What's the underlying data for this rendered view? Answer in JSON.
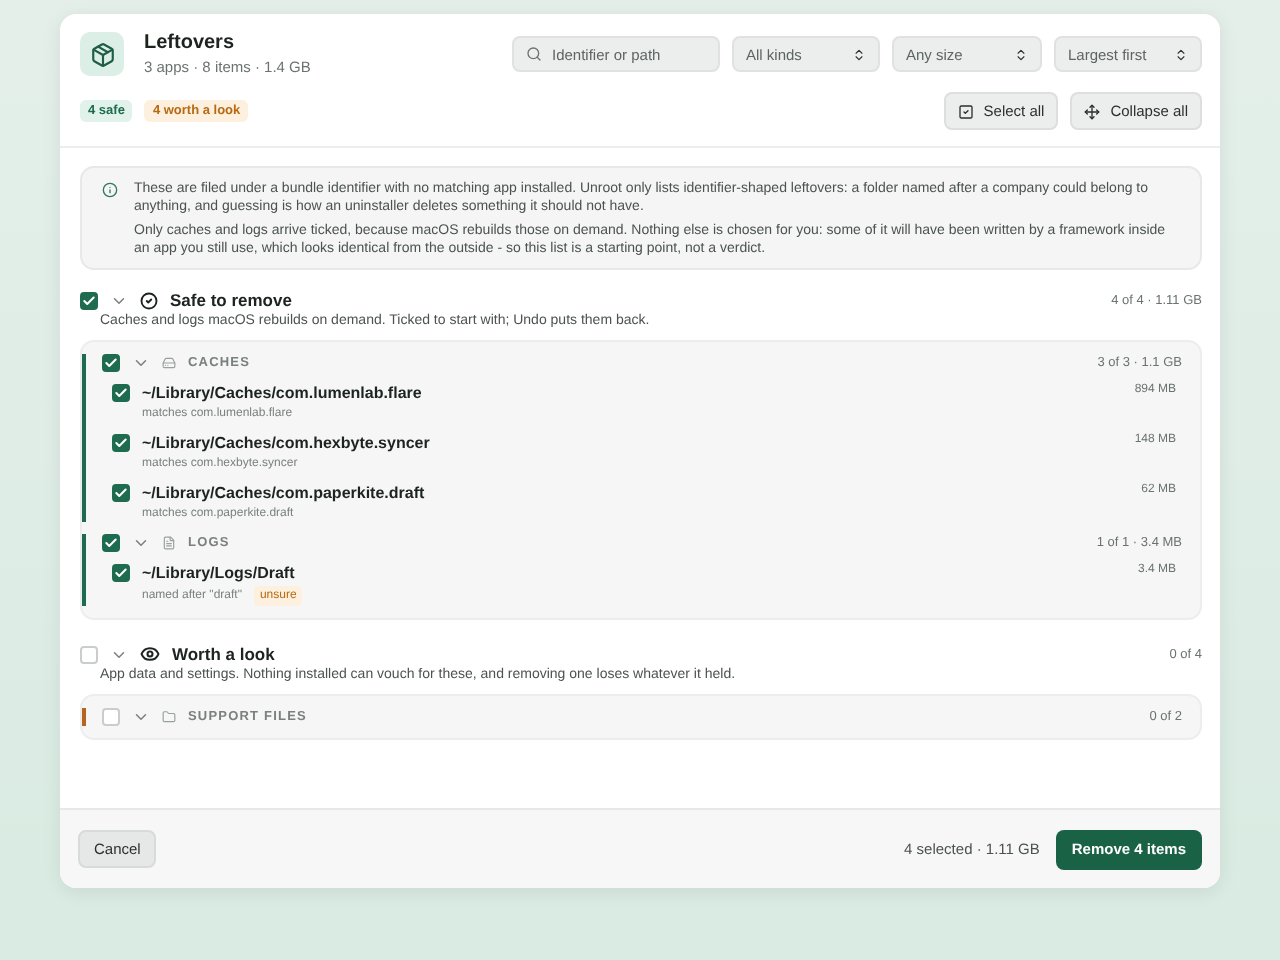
{
  "header": {
    "title": "Leftovers",
    "subtitle": "3 apps · 8 items · 1.4 GB",
    "search": {
      "placeholder": "Identifier or path"
    },
    "filters": [
      {
        "value": "All kinds"
      },
      {
        "value": "Any size"
      },
      {
        "value": "Largest first"
      }
    ],
    "badges": [
      {
        "label": "4 safe",
        "kind": "safe"
      },
      {
        "label": "4 worth a look",
        "kind": "review"
      }
    ],
    "actions": [
      {
        "label": "Select all",
        "kind": "select"
      },
      {
        "label": "Collapse all",
        "kind": "collapse"
      }
    ]
  },
  "notice": {
    "paragraphs": [
      "These are filed under a bundle identifier with no matching app installed. Unroot only lists identifier-shaped leftovers: a folder named after a company could belong to anything, and guessing is how an uninstaller deletes something it should not have.",
      "Only caches and logs arrive ticked, because macOS rebuilds those on demand. Nothing else is chosen for you: some of it will have been written by a framework inside an app you still use, which looks identical from the outside - so this list is a starting point, not a verdict."
    ]
  },
  "sections": [
    {
      "title": "Safe to remove",
      "kind": "safe",
      "checked": true,
      "expanded": true,
      "count": "4 of 4 · 1.11 GB",
      "description": "Caches and logs macOS rebuilds on demand. Ticked to start with; Undo puts them back.",
      "groups": [
        {
          "label": "CACHES",
          "kind": "caches",
          "color": "#1f6b4f",
          "checked": true,
          "expanded": true,
          "count": "3 of 3 · 1.1 GB",
          "items": [
            {
              "path": "~/Library/Caches/com.lumenlab.flare",
              "note": "matches com.lumenlab.flare",
              "size": "894 MB",
              "checked": true
            },
            {
              "path": "~/Library/Caches/com.hexbyte.syncer",
              "note": "matches com.hexbyte.syncer",
              "size": "148 MB",
              "checked": true
            },
            {
              "path": "~/Library/Caches/com.paperkite.draft",
              "note": "matches com.paperkite.draft",
              "size": "62 MB",
              "checked": true
            }
          ]
        },
        {
          "label": "LOGS",
          "kind": "logs",
          "color": "#1f6b4f",
          "checked": true,
          "expanded": true,
          "count": "1 of 1 · 3.4 MB",
          "items": [
            {
              "path": "~/Library/Logs/Draft",
              "note": "named after \"draft\"",
              "tag": "unsure",
              "size": "3.4 MB",
              "checked": true
            }
          ]
        }
      ]
    },
    {
      "title": "Worth a look",
      "kind": "review",
      "checked": false,
      "expanded": true,
      "count": "0 of 4",
      "description": "App data and settings. Nothing installed can vouch for these, and removing one loses whatever it held.",
      "groups": [
        {
          "label": "SUPPORT FILES",
          "kind": "support",
          "color": "#b5651d",
          "checked": false,
          "expanded": true,
          "count": "0 of 2"
        }
      ]
    }
  ],
  "footer": {
    "cancel": "Cancel",
    "summary": "4 selected · 1.11 GB",
    "primary": "Remove 4 items"
  }
}
